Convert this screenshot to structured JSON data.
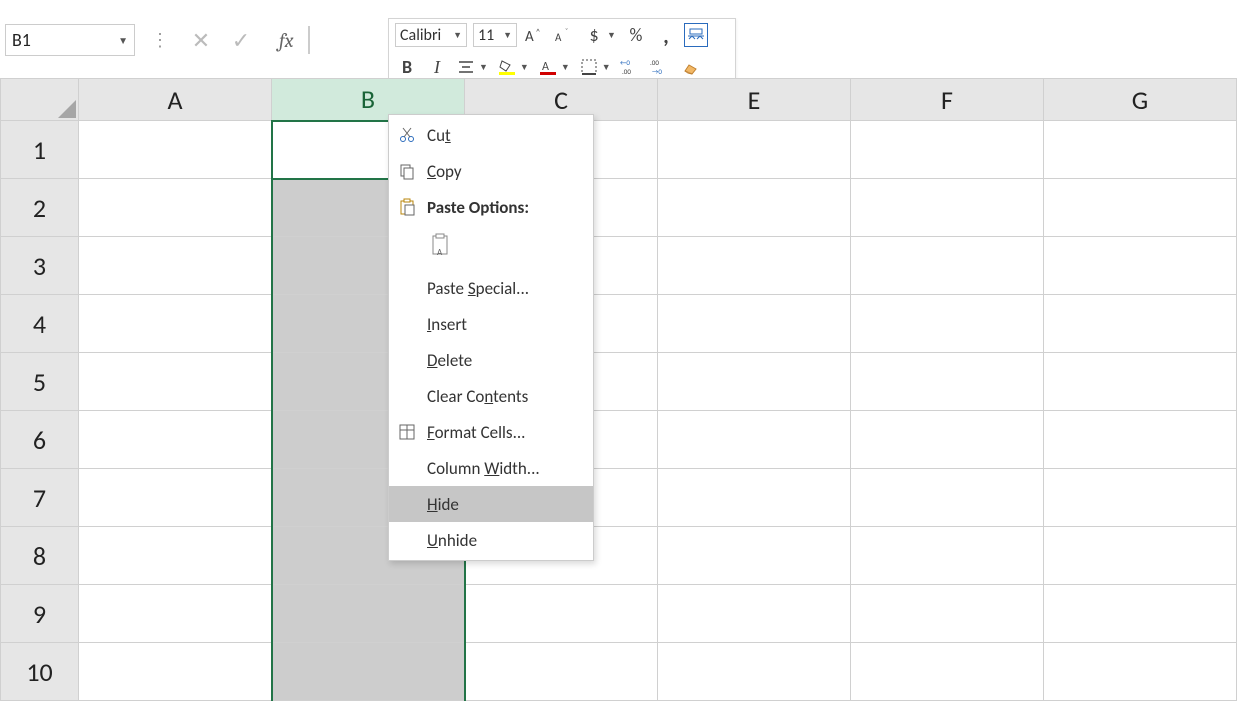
{
  "nameBox": {
    "value": "B1"
  },
  "miniToolbar": {
    "fontName": "Calibri",
    "fontSize": "11"
  },
  "columns": {
    "A": "A",
    "B": "B",
    "C": "C",
    "E": "E",
    "F": "F",
    "G": "G"
  },
  "rows": [
    "1",
    "2",
    "3",
    "4",
    "5",
    "6",
    "7",
    "8",
    "9",
    "10"
  ],
  "contextMenu": {
    "cut": "Cut",
    "copy": "Copy",
    "pasteOptionsHeader": "Paste Options:",
    "pasteSpecial": "Paste Special...",
    "insert": "Insert",
    "delete": "Delete",
    "clearContents": "Clear Contents",
    "formatCells": "Format Cells...",
    "columnWidth": "Column Width...",
    "hide": "Hide",
    "unhide": "Unhide"
  }
}
